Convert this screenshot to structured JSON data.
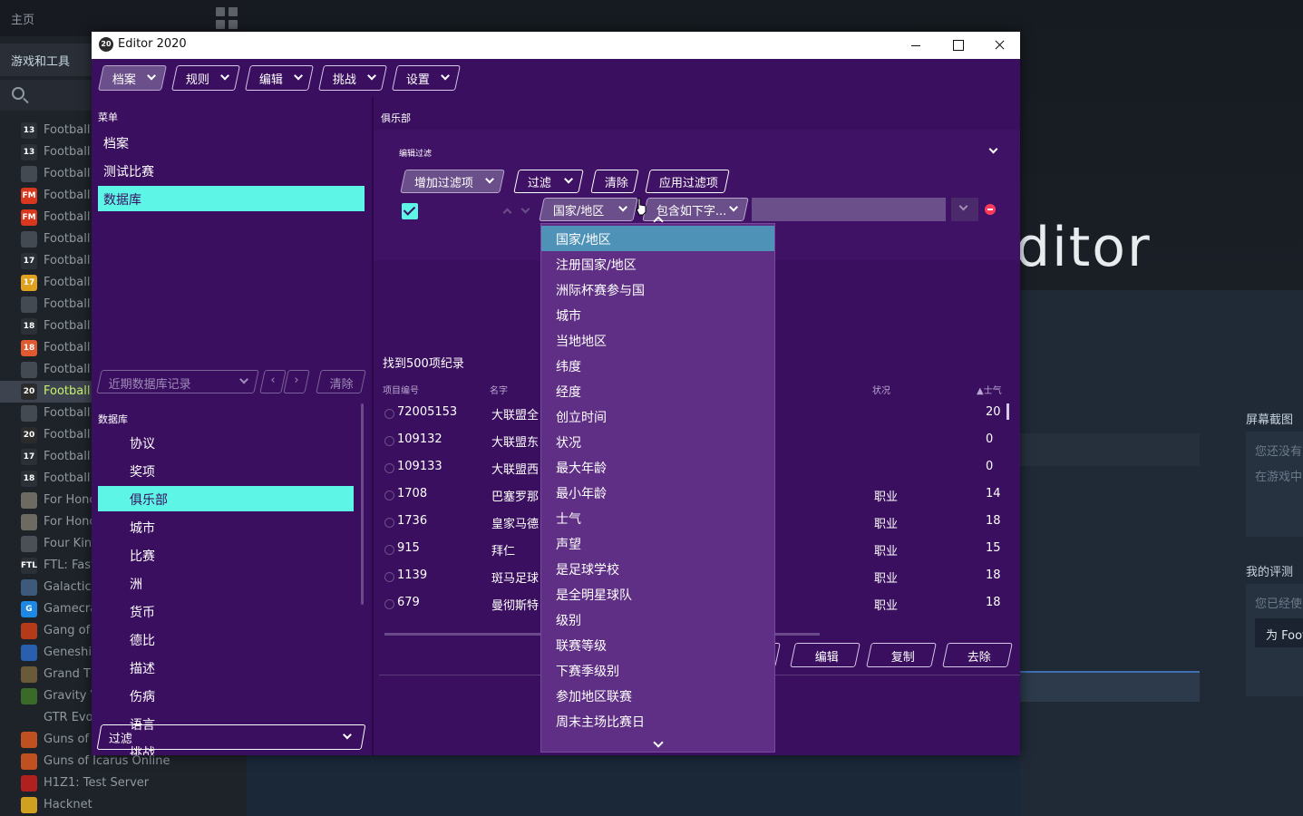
{
  "steam": {
    "home_label": "主页",
    "games_tools_label": "游戏和工具",
    "games": [
      {
        "name": "Football",
        "icon": "13",
        "color": "#2b2f36"
      },
      {
        "name": "Football",
        "icon": "13",
        "color": "#2b2f36"
      },
      {
        "name": "Football",
        "icon": "",
        "color": "#444a52"
      },
      {
        "name": "Football",
        "icon": "FM",
        "color": "#d9381e"
      },
      {
        "name": "Football",
        "icon": "FM",
        "color": "#d9381e"
      },
      {
        "name": "Football",
        "icon": "",
        "color": "#444a52"
      },
      {
        "name": "Football",
        "icon": "17",
        "color": "#2b2f36"
      },
      {
        "name": "Football",
        "icon": "17",
        "color": "#e0a020"
      },
      {
        "name": "Football",
        "icon": "",
        "color": "#444a52"
      },
      {
        "name": "Football",
        "icon": "18",
        "color": "#2b2f36"
      },
      {
        "name": "Football",
        "icon": "18",
        "color": "#e05a30"
      },
      {
        "name": "Football",
        "icon": "",
        "color": "#444a52"
      },
      {
        "name": "Football",
        "icon": "20",
        "color": "#2b2b2b",
        "active": true
      },
      {
        "name": "Football",
        "icon": "",
        "color": "#444a52"
      },
      {
        "name": "Football",
        "icon": "20",
        "color": "#2b2b2b"
      },
      {
        "name": "Football",
        "icon": "17",
        "color": "#2b2f36"
      },
      {
        "name": "Football",
        "icon": "18",
        "color": "#2b2f36"
      },
      {
        "name": "For Honc",
        "icon": "",
        "color": "#6d6a62"
      },
      {
        "name": "For Honc",
        "icon": "",
        "color": "#6d6a62"
      },
      {
        "name": "Four King",
        "icon": "",
        "color": "#4b5056"
      },
      {
        "name": "FTL: Fast",
        "icon": "FTL",
        "color": "#2b2f36"
      },
      {
        "name": "Galactic",
        "icon": "",
        "color": "#3d5a7a"
      },
      {
        "name": "Gamecra",
        "icon": "G",
        "color": "#1e88e5"
      },
      {
        "name": "Gang of",
        "icon": "",
        "color": "#b53a1a"
      },
      {
        "name": "Geneshif",
        "icon": "",
        "color": "#2a5fb0"
      },
      {
        "name": "Grand Th",
        "icon": "",
        "color": "#6b5a3a"
      },
      {
        "name": "Gravity V",
        "icon": "",
        "color": "#3a6a2a"
      },
      {
        "name": "GTR Evol",
        "icon": "",
        "color": "#1e2329"
      },
      {
        "name": "Guns of I",
        "icon": "",
        "color": "#c05020"
      },
      {
        "name": "Guns of Icarus Online",
        "icon": "",
        "color": "#c05020"
      },
      {
        "name": "H1Z1: Test Server",
        "icon": "",
        "color": "#b02020"
      },
      {
        "name": "Hacknet",
        "icon": "",
        "color": "#d0a020"
      }
    ],
    "hero_text": "ditor",
    "screenshots_title": "屏幕截图",
    "screenshots_line1": "您还没有",
    "screenshots_line2": "在游戏中",
    "review_title": "我的评测",
    "review_line": "您已经使",
    "review_button": "为 Foot"
  },
  "window": {
    "icon_text": "20",
    "title": "Editor 2020"
  },
  "menubar": {
    "items": [
      "档案",
      "规则",
      "编辑",
      "挑战",
      "设置"
    ]
  },
  "left": {
    "menu_label": "菜单",
    "menu_items": [
      "档案",
      "测试比赛",
      "数据库"
    ],
    "recent_placeholder": "近期数据库记录",
    "prev": "‹",
    "next": "›",
    "clear": "清除",
    "db_label": "数据库",
    "db_items": [
      "协议",
      "奖项",
      "俱乐部",
      "城市",
      "比赛",
      "洲",
      "货币",
      "德比",
      "描述",
      "伤病",
      "语言",
      "挑战"
    ],
    "filter_label": "过滤"
  },
  "right": {
    "club_label": "俱乐部",
    "edit_filter_label": "编辑过滤",
    "add_filter": "增加过滤项",
    "filter": "过滤",
    "clear": "清除",
    "apply_filter": "应用过滤项",
    "field_select": "国家/地区",
    "condition_select": "包含如下字...",
    "records_found": "找到500项纪录",
    "columns": {
      "id": "项目编号",
      "name": "名字",
      "status": "状况",
      "morale": "▲士气"
    },
    "rows": [
      {
        "id": "72005153",
        "name": "大联盟全",
        "status": "",
        "morale": "20"
      },
      {
        "id": "109132",
        "name": "大联盟东",
        "status": "",
        "morale": "0"
      },
      {
        "id": "109133",
        "name": "大联盟西",
        "status": "",
        "morale": "0"
      },
      {
        "id": "1708",
        "name": "巴塞罗那",
        "status": "职业",
        "morale": "14"
      },
      {
        "id": "1736",
        "name": "皇家马德",
        "status": "职业",
        "morale": "18"
      },
      {
        "id": "915",
        "name": "拜仁",
        "status": "职业",
        "morale": "15"
      },
      {
        "id": "1139",
        "name": "斑马足球",
        "status": "职业",
        "morale": "18"
      },
      {
        "id": "679",
        "name": "曼彻斯特",
        "status": "职业",
        "morale": "18"
      }
    ],
    "actions": [
      "编辑",
      "复制",
      "去除"
    ]
  },
  "dropdown": {
    "items": [
      "国家/地区",
      "注册国家/地区",
      "洲际杯赛参与国",
      "城市",
      "当地地区",
      "纬度",
      "经度",
      "创立时间",
      "状况",
      "最大年龄",
      "最小年龄",
      "士气",
      "声望",
      "是足球学校",
      "是全明星球队",
      "级别",
      "联赛等级",
      "下赛季级别",
      "参加地区联赛",
      "周末主场比赛日"
    ],
    "highlight_index": 0
  },
  "colors": {
    "editor_bg": "#3a0f5f",
    "accent_cyan": "#5cf5e6",
    "dropdown_bg": "#5f2f85",
    "dropdown_highlight": "#4f92b8",
    "remove_red": "#ff3b5c"
  }
}
